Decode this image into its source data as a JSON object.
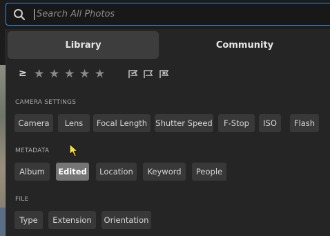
{
  "search": {
    "placeholder": "Search All Photos",
    "value": ""
  },
  "tabs": [
    {
      "label": "Library",
      "selected": true
    },
    {
      "label": "Community",
      "selected": false
    }
  ],
  "rating": {
    "operator": "≥",
    "stars": [
      "☆",
      "★",
      "★",
      "★",
      "★"
    ],
    "icons": [
      "flag-picked-icon",
      "flag-unflagged-icon",
      "flag-rejected-icon"
    ]
  },
  "sections": {
    "camera": {
      "title": "CAMERA SETTINGS",
      "chips": [
        "Camera",
        "Lens",
        "Focal Length",
        "Shutter Speed",
        "F-Stop",
        "ISO",
        "Flash"
      ]
    },
    "metadata": {
      "title": "METADATA",
      "chips": [
        "Album",
        "Edited",
        "Location",
        "Keyword",
        "People"
      ],
      "active": "Edited"
    },
    "file": {
      "title": "FILE",
      "chips": [
        "Type",
        "Extension",
        "Orientation"
      ]
    }
  },
  "colors": {
    "accent_border": "#3a8ee6",
    "panel_bg": "#252525",
    "chip_bg": "#383838",
    "chip_active_bg": "#757575",
    "cursor": "#f3e23a"
  }
}
